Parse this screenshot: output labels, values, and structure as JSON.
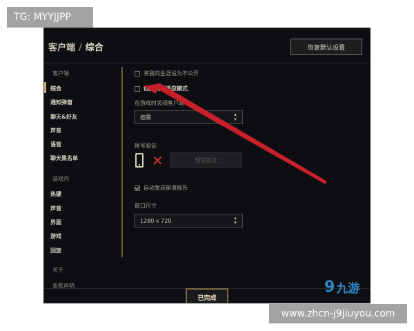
{
  "overlay": {
    "tg_badge": "TG: MYYJJPP",
    "url_badge": "www.zhcn-j9jiuyou.com",
    "logo_mark": "9",
    "logo_text": "九游"
  },
  "header": {
    "breadcrumb_parent": "客户端",
    "breadcrumb_separator": "/",
    "breadcrumb_current": "综合",
    "restore_defaults": "恢复默认设置"
  },
  "sidebar": {
    "group_client": "客户端",
    "client_items": [
      "综合",
      "通知弹窗",
      "聊天&好友",
      "声音",
      "语音",
      "聊天黑名单"
    ],
    "group_ingame": "游戏内",
    "ingame_items": [
      "热键",
      "声音",
      "界面",
      "游戏",
      "回放"
    ],
    "group_about": "关于",
    "about_items": [
      "条款声明"
    ]
  },
  "main": {
    "private_profile_label": "将我的生涯设为不公开",
    "private_profile_checked": false,
    "low_spec_label": "低配机器适应模式",
    "low_spec_checked": false,
    "close_client_label": "在游戏时关闭客户端",
    "close_client_value": "按需",
    "account_verify_label": "帐号验证",
    "verify_button": "短信验证",
    "crash_report_label": "自动发送崩溃报告",
    "crash_report_checked": true,
    "window_size_label": "窗口尺寸",
    "window_size_value": "1280 x 720"
  },
  "footer": {
    "done_button": "已完成"
  },
  "icons": {
    "caret_up": "▴",
    "caret_down": "▾",
    "x_mark": "✕"
  },
  "colors": {
    "gold_accent": "#c8aa6e",
    "background": "#0c0e12",
    "arrow_red": "#c8202a",
    "logo_blue": "#2f86c9"
  }
}
